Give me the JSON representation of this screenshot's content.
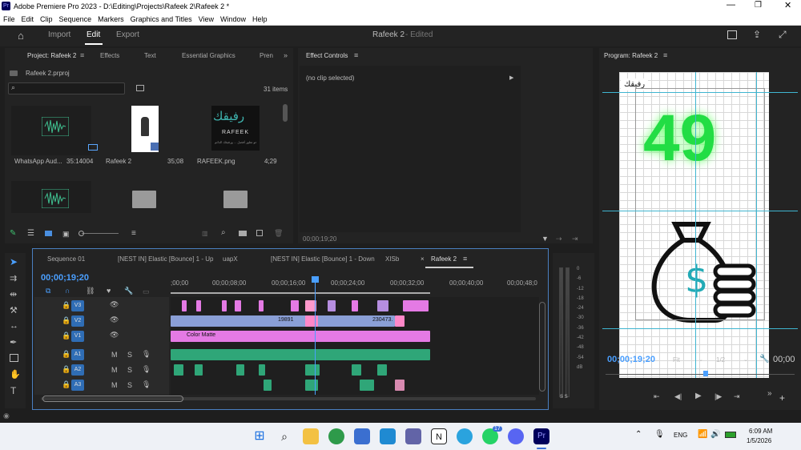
{
  "window": {
    "title": "Adobe Premiere Pro 2023 - D:\\Editing\\Projects\\Rafeek 2\\Rafeek 2 *",
    "logo": "Pr"
  },
  "menu": [
    "File",
    "Edit",
    "Clip",
    "Sequence",
    "Markers",
    "Graphics and Titles",
    "View",
    "Window",
    "Help"
  ],
  "header": {
    "tabs": [
      "Import",
      "Edit",
      "Export"
    ],
    "active": "Edit",
    "project_title": "Rafeek 2",
    "status": "- Edited"
  },
  "project": {
    "tabs": [
      "Project: Rafeek 2",
      "Effects",
      "Text",
      "Essential Graphics",
      "Pren"
    ],
    "file": "Rafeek 2.prproj",
    "count": "31 items",
    "items": [
      {
        "name": "WhatsApp Aud...",
        "dur": "35:14004"
      },
      {
        "name": "Rafeek 2",
        "dur": "35;08"
      },
      {
        "name": "RAFEEK.png",
        "dur": "4;29"
      }
    ],
    "logo_ar": "رفيقك",
    "logo_en": "RAFEEK",
    "logo_sub": "نحو تطور أفضل ... ورفيقك الدائم"
  },
  "effect_controls": {
    "title": "Effect Controls",
    "no_clip": "(no clip selected)",
    "timecode": "00;00;19;20"
  },
  "program": {
    "title": "Program: Rafeek 2",
    "timecode": "00;00;19;20",
    "fit": "Fit",
    "res": "1/2",
    "end_tc": "00;00",
    "number": "49",
    "stamp": "رفيقك"
  },
  "timeline": {
    "tabs": [
      "Sequence 01",
      "[NEST IN] Elastic [Bounce] 1 - Up",
      "uapX",
      "[NEST IN] Elastic [Bounce] 1 - Down",
      "XISb",
      "Rafeek 2"
    ],
    "timecode": "00;00;19;20",
    "ruler": [
      ";00;00",
      "00;00;08;00",
      "00;00;16;00",
      "00;00;24;00",
      "00;00;32;00",
      "00;00;40;00",
      "00;00;48;0"
    ],
    "tracks": [
      "V3",
      "V2",
      "V1",
      "A1",
      "A2",
      "A3"
    ],
    "clip_labels": {
      "matte": "Color Matte",
      "c1": "19891",
      "c2": "230473."
    }
  },
  "meter": {
    "scale": [
      "0",
      "-6",
      "-12",
      "-18",
      "-24",
      "-30",
      "-36",
      "-42",
      "-48",
      "-54",
      "dB"
    ],
    "solo": "S S"
  },
  "taskbar": {
    "time": "6:09 AM",
    "date": "1/5/2026",
    "lang": "ENG",
    "badge": "17"
  }
}
